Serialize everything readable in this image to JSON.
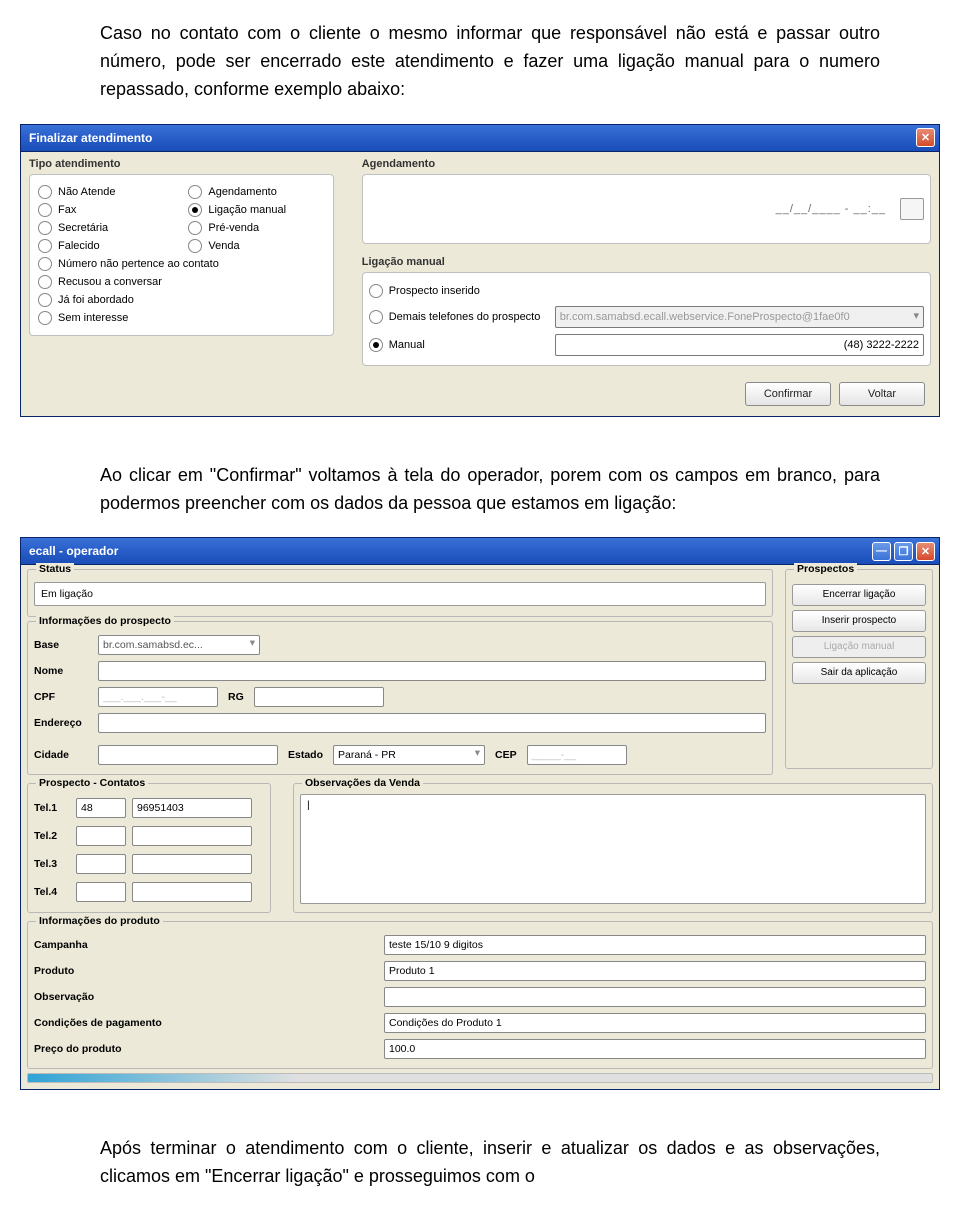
{
  "doc": {
    "p1": "Caso no contato com o cliente o mesmo informar que responsável não está e passar outro número, pode ser encerrado este atendimento e fazer uma ligação manual para o numero repassado, conforme exemplo abaixo:",
    "p2": "Ao clicar em \"Confirmar\" voltamos à tela do operador, porem com os campos em branco, para podermos preencher com os dados da pessoa que estamos em ligação:",
    "p3": "Após terminar o atendimento com o cliente, inserir e atualizar os dados e as observações, clicamos em \"Encerrar ligação\" e prosseguimos com o"
  },
  "dialog": {
    "title": "Finalizar atendimento",
    "section_tipo": "Tipo atendimento",
    "section_agend": "Agendamento",
    "section_manual": "Ligação manual",
    "tipo_left": [
      "Não Atende",
      "Fax",
      "Secretária",
      "Falecido",
      "Número não pertence ao contato",
      "Recusou a conversar",
      "Já foi abordado",
      "Sem interesse"
    ],
    "tipo_right": [
      "Agendamento",
      "Ligação manual",
      "Pré-venda",
      "Venda"
    ],
    "tipo_selected": "Ligação manual",
    "agend_mask": "__/__/____ - __:__",
    "manual_opts": [
      "Prospecto inserido",
      "Demais telefones do prospecto",
      "Manual"
    ],
    "manual_selected": "Manual",
    "demais_value": "br.com.samabsd.ecall.webservice.FoneProspecto@1fae0f0",
    "manual_value": "(48) 3222-2222",
    "btn_confirm": "Confirmar",
    "btn_back": "Voltar",
    "close_glyph": "✕"
  },
  "op": {
    "title": "ecall - operador",
    "min_glyph": "—",
    "max_glyph": "❐",
    "close_glyph": "✕",
    "section_status": "Status",
    "status_value": "Em ligação",
    "section_prospectos": "Prospectos",
    "btn_encerrar": "Encerrar ligação",
    "btn_inserir": "Inserir prospecto",
    "btn_ligacao": "Ligação manual",
    "btn_sair": "Sair da aplicação",
    "section_info": "Informações do prospecto",
    "lbl_base": "Base",
    "base_value": "br.com.samabsd.ec...",
    "lbl_nome": "Nome",
    "nome_value": "",
    "lbl_cpf": "CPF",
    "cpf_value": "___.___.___-__",
    "lbl_rg": "RG",
    "rg_value": "",
    "lbl_end": "Endereço",
    "end_value": "",
    "lbl_cidade": "Cidade",
    "cidade_value": "",
    "lbl_estado": "Estado",
    "estado_value": "Paraná - PR",
    "lbl_cep": "CEP",
    "cep_value": "_____-__",
    "section_contatos": "Prospecto - Contatos",
    "section_obs": "Observações da Venda",
    "obs_value": "|",
    "tel_labels": [
      "Tel.1",
      "Tel.2",
      "Tel.3",
      "Tel.4"
    ],
    "tel1_ddd": "48",
    "tel1_num": "96951403",
    "section_prod": "Informações do produto",
    "prod_rows": [
      {
        "label": "Campanha",
        "value": "teste 15/10 9 digitos"
      },
      {
        "label": "Produto",
        "value": "Produto 1"
      },
      {
        "label": "Observação",
        "value": ""
      },
      {
        "label": "Condições de pagamento",
        "value": "Condições do Produto 1"
      },
      {
        "label": "Preço do produto",
        "value": "100.0"
      }
    ]
  }
}
